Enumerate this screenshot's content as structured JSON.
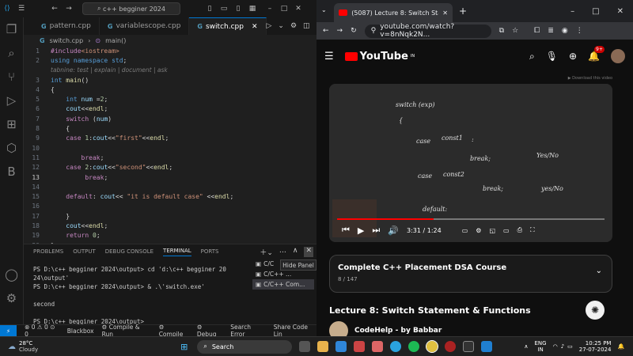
{
  "vscode": {
    "search": "c++ begginer 2024",
    "tabs": [
      {
        "label": "pattern.cpp"
      },
      {
        "label": "variablescope.cpp"
      },
      {
        "label": "switch.cpp"
      }
    ],
    "breadcrumb": {
      "file": "switch.cpp",
      "symbol": "main()"
    },
    "hint": "tabnine: test | explain | document | ask",
    "lines": [
      {
        "n": "1",
        "html": "<span class='tk-pp'>#include</span><span class='tk-str'>&lt;iostream&gt;</span>"
      },
      {
        "n": "2",
        "html": "<span class='tk-kw'>using namespace</span> <span class='tk-ty'>std</span><span class='tk-tx'>;</span>"
      },
      {
        "n": "",
        "hint": true
      },
      {
        "n": "3",
        "html": "<span class='tk-ty'>int</span> <span class='tk-fn'>main</span><span class='tk-tx'>()</span>"
      },
      {
        "n": "4",
        "html": "<span class='tk-tx'>{</span>"
      },
      {
        "n": "5",
        "html": "    <span class='tk-ty'>int</span> <span class='tk-id'>num</span> <span class='tk-tx'>=</span><span class='tk-nm'>2</span><span class='tk-tx'>;</span>"
      },
      {
        "n": "6",
        "html": "    <span class='tk-id'>cout</span><span class='tk-tx'>&lt;&lt;</span><span class='tk-fn'>endl</span><span class='tk-tx'>;</span>"
      },
      {
        "n": "7",
        "html": "    <span class='tk-ctl'>switch</span> <span class='tk-tx'>(</span><span class='tk-id'>num</span><span class='tk-tx'>)</span>"
      },
      {
        "n": "8",
        "html": "    <span class='tk-tx'>{</span>"
      },
      {
        "n": "9",
        "html": "    <span class='tk-ctl'>case</span> <span class='tk-nm'>1</span><span class='tk-tx'>:</span><span class='tk-id'>cout</span><span class='tk-tx'>&lt;&lt;</span><span class='tk-str'>\"first\"</span><span class='tk-tx'>&lt;&lt;</span><span class='tk-fn'>endl</span><span class='tk-tx'>;</span>"
      },
      {
        "n": "10",
        "html": ""
      },
      {
        "n": "11",
        "html": "        <span class='tk-ctl'>break</span><span class='tk-tx'>;</span>"
      },
      {
        "n": "12",
        "html": "    <span class='tk-ctl'>case</span> <span class='tk-nm'>2</span><span class='tk-tx'>:</span><span class='tk-id'>cout</span><span class='tk-tx'>&lt;&lt;</span><span class='tk-str'>\"second\"</span><span class='tk-tx'>&lt;&lt;</span><span class='tk-fn'>endl</span><span class='tk-tx'>;</span>"
      },
      {
        "n": "13",
        "html": "         <span class='tk-ctl'>break</span><span class='tk-tx'>;</span>",
        "cur": true
      },
      {
        "n": "14",
        "html": ""
      },
      {
        "n": "15",
        "html": "    <span class='tk-ctl'>default</span><span class='tk-tx'>:</span> <span class='tk-id'>cout</span><span class='tk-tx'>&lt;&lt;</span> <span class='tk-str'>\"it is default case\"</span> <span class='tk-tx'>&lt;&lt;</span><span class='tk-fn'>endl</span><span class='tk-tx'>;</span>"
      },
      {
        "n": "16",
        "html": ""
      },
      {
        "n": "17",
        "html": "    <span class='tk-tx'>}</span>"
      },
      {
        "n": "18",
        "html": "    <span class='tk-id'>cout</span><span class='tk-tx'>&lt;&lt;</span><span class='tk-fn'>endl</span><span class='tk-tx'>;</span>"
      },
      {
        "n": "19",
        "html": "    <span class='tk-ctl'>return</span> <span class='tk-nm'>0</span><span class='tk-tx'>;</span>"
      },
      {
        "n": "20",
        "html": "<span class='tk-tx'>}</span>"
      }
    ],
    "panel_tabs": [
      "PROBLEMS",
      "OUTPUT",
      "DEBUG CONSOLE",
      "TERMINAL",
      "PORTS"
    ],
    "terminal_text": "PS D:\\c++ begginer 2024\\output> cd 'd:\\c++ begginer 20\n24\\output'\nPS D:\\c++ begginer 2024\\output> & .\\'switch.exe'\n\nsecond\n\nPS D:\\c++ begginer 2024\\output> ",
    "terminal_list": [
      "C/C",
      "C/C++ ...",
      "C/C++ Com..."
    ],
    "hide_panel": "Hide Panel",
    "status": {
      "errors": "0",
      "warnings": "0",
      "extra": "0",
      "blackbox": "Blackbox",
      "compile_run": "Compile & Run",
      "compile": "Compile",
      "debug": "Debug",
      "search_error": "Search Error",
      "share": "Share Code Lin"
    }
  },
  "chrome": {
    "tab_title": "(5087) Lecture 8: Switch Statemen",
    "url": "youtube.com/watch?v=8nNqk2N...",
    "notif": "9+",
    "yt_country": "IN",
    "yt_brand": "YouTube",
    "video_badge": "▶ Download this video",
    "time": "3:31 / 1:24",
    "playlist_title": "Complete C++ Placement DSA Course",
    "playlist_pos": "8 / 147",
    "video_title": "Lecture 8: Switch Statement & Functions",
    "channel": "CodeHelp - by Babbar",
    "chalk": [
      "switch (exp)",
      "{",
      "case",
      "const1",
      ":",
      "break;",
      "Yes/No",
      "case",
      "const2",
      "break;",
      "yes/No",
      "default:"
    ]
  },
  "taskbar": {
    "weather_temp": "28°C",
    "weather_desc": "Cloudy",
    "search": "Search",
    "lang1": "ENG",
    "lang2": "IN",
    "clock": "10:25 PM",
    "date": "27-07-2024"
  },
  "progress": 0.36
}
